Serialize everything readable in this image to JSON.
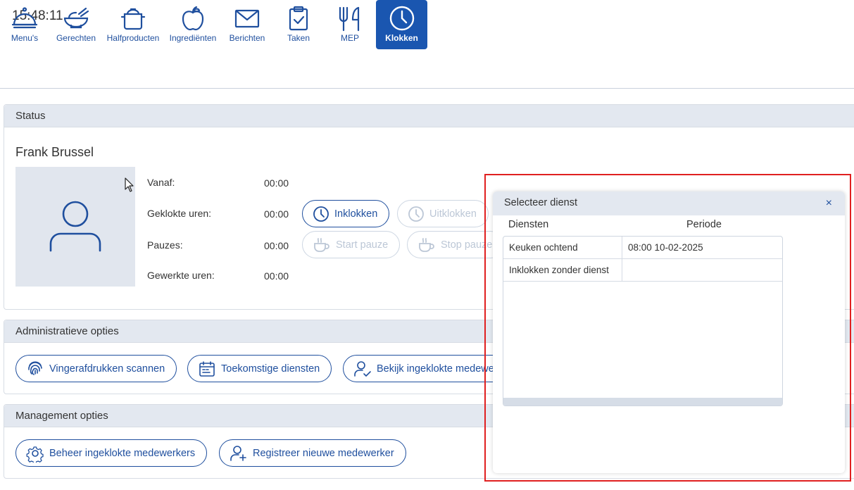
{
  "clock": "15:48:11",
  "nav": [
    {
      "label": "Menu's",
      "icon": "cloche-icon"
    },
    {
      "label": "Gerechten",
      "icon": "bowl-icon"
    },
    {
      "label": "Halfproducten",
      "icon": "pot-icon"
    },
    {
      "label": "Ingrediënten",
      "icon": "apple-icon"
    },
    {
      "label": "Berichten",
      "icon": "envelope-icon"
    },
    {
      "label": "Taken",
      "icon": "clipboard-check-icon"
    },
    {
      "label": "MEP",
      "icon": "fork-knife-icon"
    },
    {
      "label": "Klokken",
      "icon": "clock-icon",
      "active": true
    }
  ],
  "status": {
    "title": "Status",
    "person_name": "Frank Brussel",
    "rows": [
      {
        "label": "Vanaf:",
        "value": "00:00"
      },
      {
        "label": "Geklokte uren:",
        "value": "00:00"
      },
      {
        "label": "Pauzes:",
        "value": "00:00"
      },
      {
        "label": "Gewerkte uren:",
        "value": "00:00"
      }
    ],
    "buttons": {
      "clock_in": "Inklokken",
      "clock_out": "Uitklokken",
      "start_break": "Start pauze",
      "stop_break": "Stop pauze"
    }
  },
  "admin": {
    "title": "Administratieve opties",
    "buttons": [
      "Vingerafdrukken scannen",
      "Toekomstige diensten",
      "Bekijk ingeklokte medewerkers"
    ]
  },
  "management": {
    "title": "Management opties",
    "buttons": [
      "Beheer ingeklokte medewerkers",
      "Registreer nieuwe medewerker"
    ]
  },
  "dialog": {
    "title": "Selecteer dienst",
    "close": "×",
    "columns": [
      "Diensten",
      "Periode"
    ],
    "rows": [
      {
        "dienst": "Keuken ochtend",
        "periode": "08:00 10-02-2025"
      },
      {
        "dienst": "Inklokken zonder dienst",
        "periode": ""
      }
    ]
  },
  "colors": {
    "accent": "#1a56b0",
    "header_bg": "#e3e8f0",
    "highlight": "#e02020"
  }
}
